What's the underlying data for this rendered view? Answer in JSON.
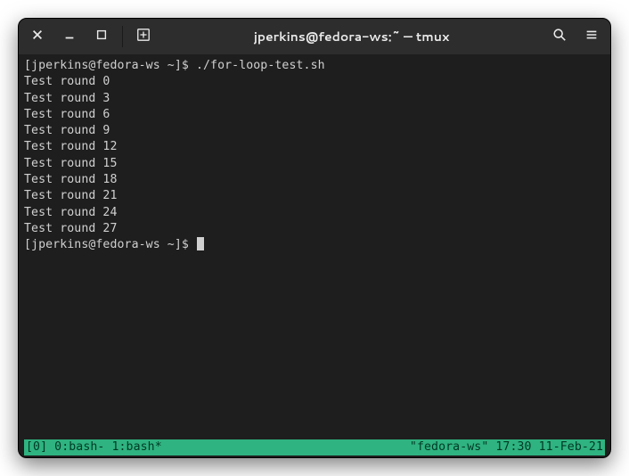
{
  "titlebar": {
    "title": "jperkins@fedora-ws:~ — tmux"
  },
  "terminal": {
    "prompt1": "[jperkins@fedora-ws ~]$ ",
    "command": "./for-loop-test.sh",
    "output_lines": [
      "Test round 0",
      "Test round 3",
      "Test round 6",
      "Test round 9",
      "Test round 12",
      "Test round 15",
      "Test round 18",
      "Test round 21",
      "Test round 24",
      "Test round 27"
    ],
    "prompt2": "[jperkins@fedora-ws ~]$ "
  },
  "statusbar": {
    "left": "[0] 0:bash- 1:bash*",
    "right": "\"fedora-ws\" 17:30 11-Feb-21"
  },
  "colors": {
    "statusbar_bg": "#2fb380",
    "terminal_bg": "#1e1e1e",
    "titlebar_bg": "#2d2d2d",
    "text": "#d0d0d0"
  }
}
